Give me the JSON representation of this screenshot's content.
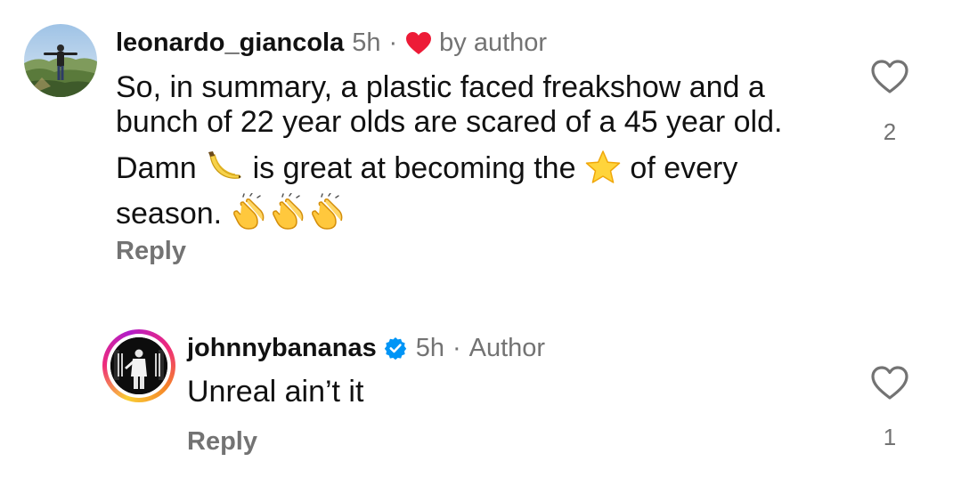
{
  "comments": [
    {
      "username": "leonardo_giancola",
      "time": "5h",
      "separator": "·",
      "liked_label": "by author",
      "text_line1": "So, in summary, a plastic faced freakshow and a bunch of 22 year olds are scared of a 45 year old.",
      "text_line2_a": "Damn",
      "text_line2_b": "is great at becoming the",
      "text_line2_c": "of every season.",
      "emojis": [
        "banana-icon",
        "star-icon",
        "clapping-hands-icon",
        "clapping-hands-icon",
        "clapping-hands-icon"
      ],
      "reply_label": "Reply",
      "like_count": "2"
    },
    {
      "username": "johnnybananas",
      "verified": true,
      "time": "5h",
      "separator": "·",
      "author_label": "Author",
      "text": "Unreal ain’t it",
      "reply_label": "Reply",
      "like_count": "1"
    }
  ],
  "colors": {
    "text": "#111111",
    "secondary": "#737373",
    "heart_red": "#ed1b37",
    "verified_blue": "#0095f6"
  }
}
